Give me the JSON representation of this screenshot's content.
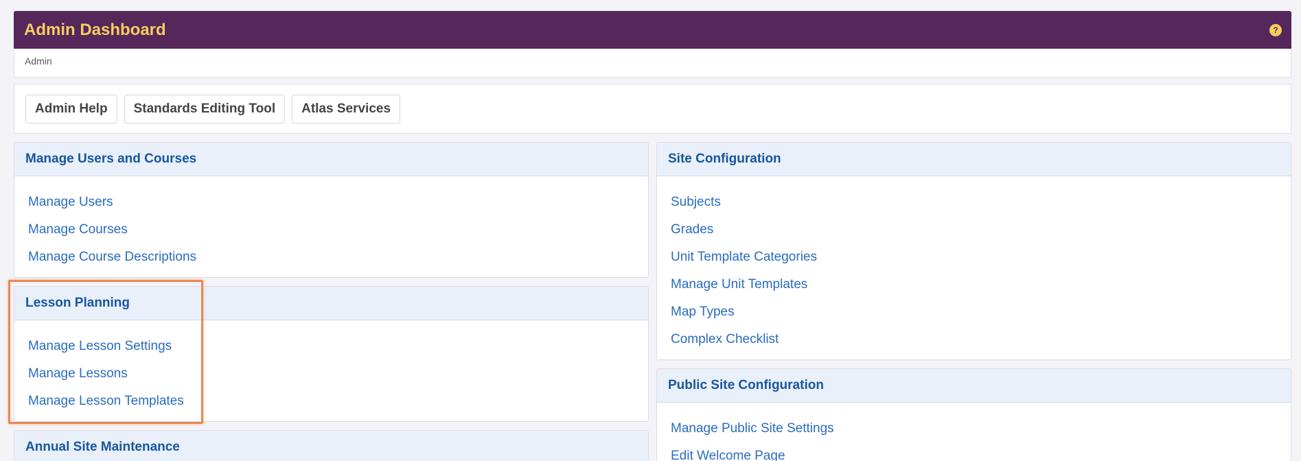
{
  "header": {
    "title": "Admin Dashboard",
    "help_icon": "question-circle-icon",
    "help_glyph": "?"
  },
  "breadcrumb": {
    "label": "Admin"
  },
  "toolbar": {
    "buttons": [
      "Admin Help",
      "Standards Editing Tool",
      "Atlas Services"
    ]
  },
  "panels": {
    "users_courses": {
      "title": "Manage Users and Courses",
      "links": [
        "Manage Users",
        "Manage Courses",
        "Manage Course Descriptions"
      ]
    },
    "lesson_planning": {
      "title": "Lesson Planning",
      "links": [
        "Manage Lesson Settings",
        "Manage Lessons",
        "Manage Lesson Templates"
      ]
    },
    "annual_maintenance": {
      "title": "Annual Site Maintenance"
    },
    "site_config": {
      "title": "Site Configuration",
      "links": [
        "Subjects",
        "Grades",
        "Unit Template Categories",
        "Manage Unit Templates",
        "Map Types",
        "Complex Checklist"
      ]
    },
    "public_site": {
      "title": "Public Site Configuration",
      "links": [
        "Manage Public Site Settings",
        "Edit Welcome Page"
      ]
    }
  },
  "colors": {
    "header_bg": "#55275a",
    "header_title": "#f7cd5f",
    "panel_head_bg": "#e9f0fa",
    "panel_title": "#17569d",
    "link": "#2a6cc0",
    "highlight": "#ec874e"
  }
}
